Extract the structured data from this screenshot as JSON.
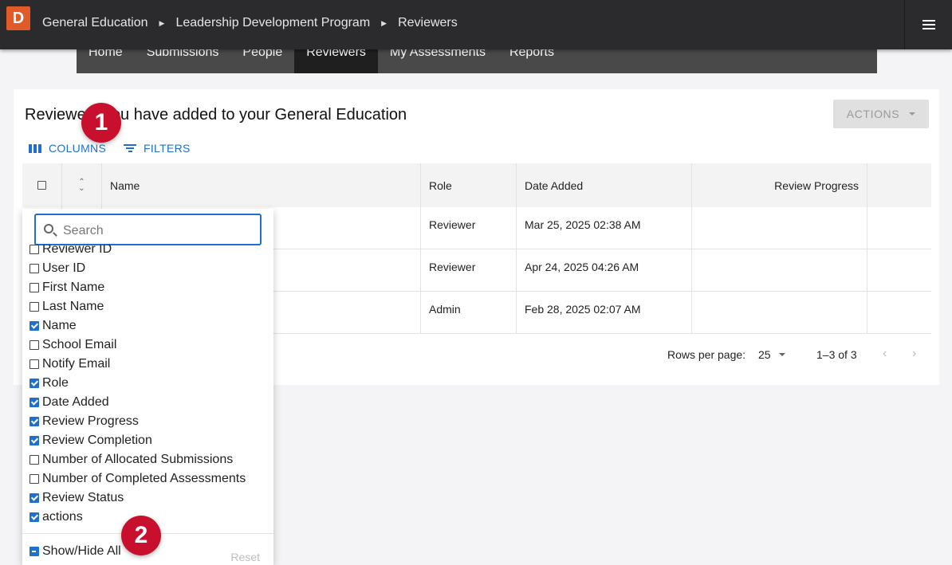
{
  "topbar": {
    "logo_letter": "D",
    "breadcrumbs": [
      "General Education",
      "Leadership Development Program",
      "Reviewers"
    ]
  },
  "nav": {
    "items": [
      "Home",
      "Submissions",
      "People",
      "Reviewers",
      "My Assessments",
      "Reports"
    ],
    "active": "Reviewers"
  },
  "card": {
    "title": "Reviewers you have added to your General Education",
    "actions_label": "ACTIONS",
    "columns_label": "COLUMNS",
    "filters_label": "FILTERS"
  },
  "table": {
    "headers": {
      "name": "Name",
      "role": "Role",
      "date": "Date Added",
      "progress": "Review Progress"
    },
    "rows": [
      {
        "role": "Reviewer",
        "date": "Mar 25, 2025 02:38 AM"
      },
      {
        "role": "Reviewer",
        "date": "Apr 24, 2025 04:26 AM"
      },
      {
        "role": "Admin",
        "date": "Feb 28, 2025 02:07 AM"
      }
    ],
    "pagination": {
      "rows_per_page_label": "Rows per page:",
      "rows_per_page": "25",
      "range": "1–3 of 3"
    }
  },
  "column_panel": {
    "search_placeholder": "Search",
    "items": [
      {
        "label": "Reviewer ID",
        "checked": false
      },
      {
        "label": "User ID",
        "checked": false
      },
      {
        "label": "First Name",
        "checked": false
      },
      {
        "label": "Last Name",
        "checked": false
      },
      {
        "label": "Name",
        "checked": true
      },
      {
        "label": "School Email",
        "checked": false
      },
      {
        "label": "Notify Email",
        "checked": false
      },
      {
        "label": "Role",
        "checked": true
      },
      {
        "label": "Date Added",
        "checked": true
      },
      {
        "label": "Review Progress",
        "checked": true
      },
      {
        "label": "Review Completion",
        "checked": true
      },
      {
        "label": "Number of Allocated Submissions",
        "checked": false
      },
      {
        "label": "Number of Completed Assessments",
        "checked": false
      },
      {
        "label": "Review Status",
        "checked": true
      },
      {
        "label": "actions",
        "checked": true
      }
    ],
    "show_hide_label": "Show/Hide All",
    "reset_label": "Reset"
  },
  "markers": [
    "1",
    "2"
  ],
  "colors": {
    "accent": "#1e6fd0",
    "marker": "#c8102e",
    "logo": "#e05a2a",
    "topbar": "#2b2b2d"
  }
}
